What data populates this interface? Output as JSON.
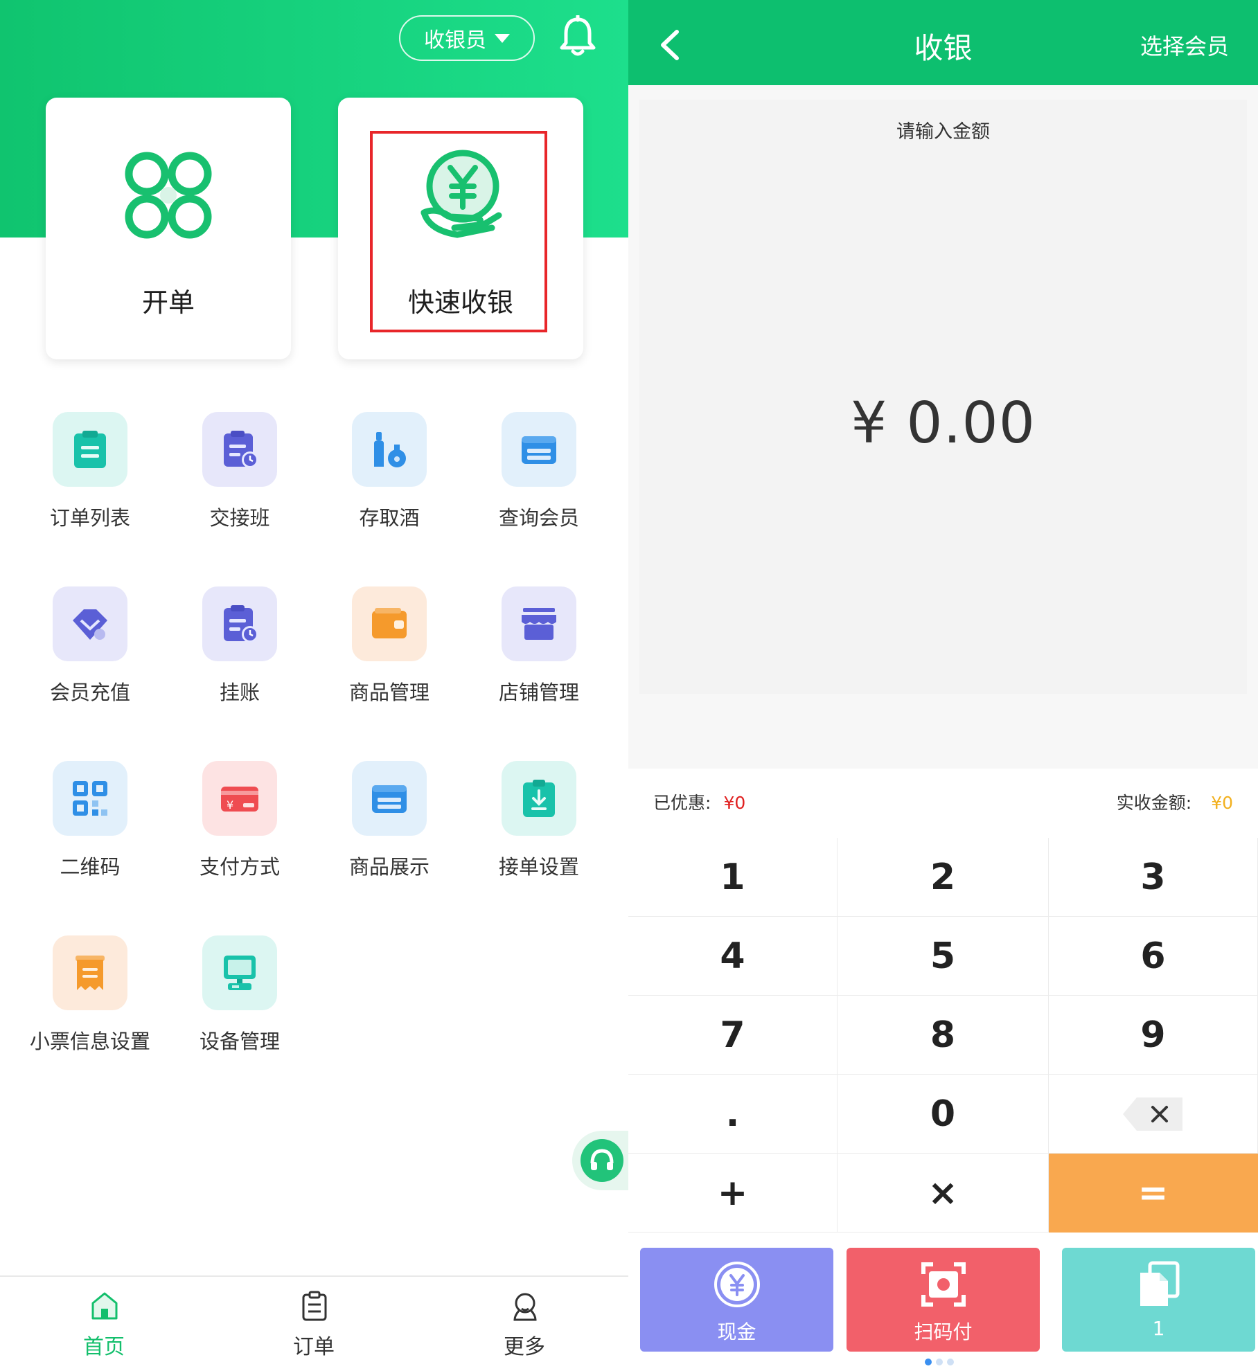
{
  "left": {
    "role_selector": "收银员",
    "cards": [
      {
        "label": "开单"
      },
      {
        "label": "快速收银"
      }
    ],
    "grid": [
      {
        "label": "订单列表",
        "icon": "order-list-icon"
      },
      {
        "label": "交接班",
        "icon": "shift-handover-icon"
      },
      {
        "label": "存取酒",
        "icon": "wine-storage-icon"
      },
      {
        "label": "查询会员",
        "icon": "member-card-icon"
      },
      {
        "label": "会员充值",
        "icon": "member-recharge-icon"
      },
      {
        "label": "挂账",
        "icon": "credit-account-icon"
      },
      {
        "label": "商品管理",
        "icon": "product-management-icon"
      },
      {
        "label": "店铺管理",
        "icon": "store-management-icon"
      },
      {
        "label": "二维码",
        "icon": "qr-code-icon"
      },
      {
        "label": "支付方式",
        "icon": "payment-method-icon"
      },
      {
        "label": "商品展示",
        "icon": "product-display-icon"
      },
      {
        "label": "接单设置",
        "icon": "order-settings-icon"
      },
      {
        "label": "小票信息设置",
        "icon": "receipt-settings-icon"
      },
      {
        "label": "设备管理",
        "icon": "device-management-icon"
      }
    ],
    "tabs": [
      {
        "label": "首页",
        "active": true
      },
      {
        "label": "订单",
        "active": false
      },
      {
        "label": "更多",
        "active": false
      }
    ]
  },
  "right": {
    "title": "收银",
    "select_member": "选择会员",
    "prompt": "请输入金额",
    "amount": "¥ 0.00",
    "discount_label": "已优惠:",
    "discount_value": "¥0",
    "received_label": "实收金额:",
    "received_value": "¥0",
    "keys": [
      "1",
      "2",
      "3",
      "4",
      "5",
      "6",
      "7",
      "8",
      "9",
      ".",
      "0",
      "",
      "+",
      "×",
      "="
    ],
    "pay_buttons": [
      {
        "label": "现金",
        "color": "#8a8ff2"
      },
      {
        "label": "扫码付",
        "color": "#f2606a"
      },
      {
        "label": "1",
        "color": "#6ed9d2"
      }
    ]
  },
  "colors": {
    "brand_green": "#10c46f",
    "highlight_red": "#e8262a",
    "equals_orange": "#f9a84f"
  }
}
